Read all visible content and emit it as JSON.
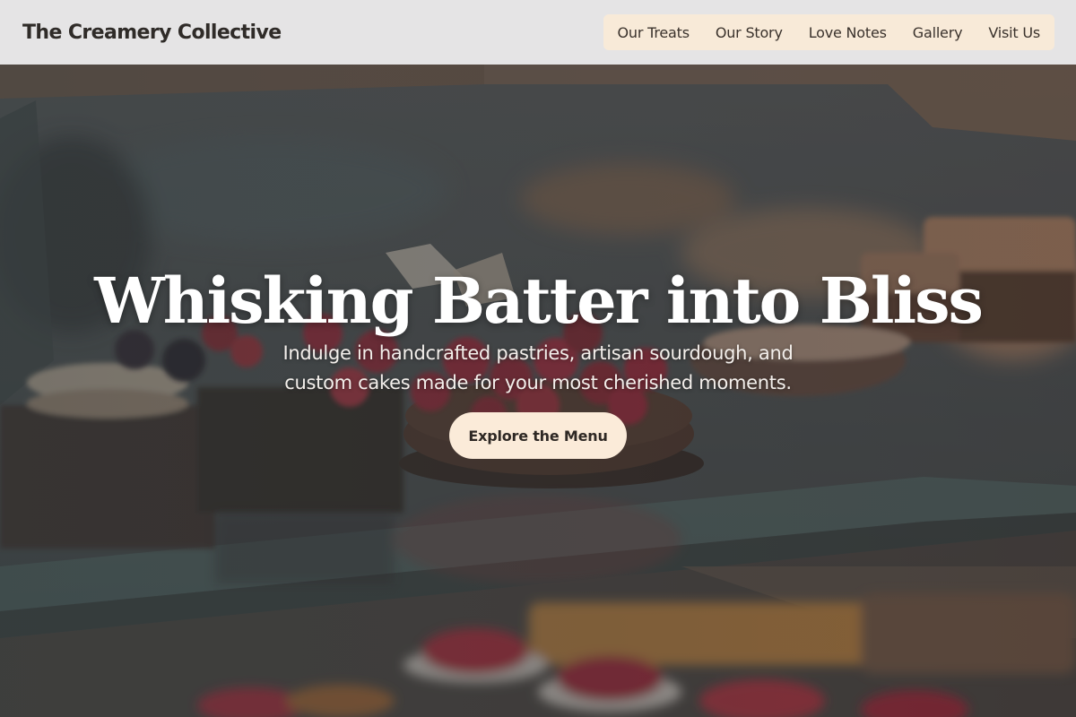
{
  "header": {
    "brand": "The Creamery Collective",
    "nav": [
      {
        "label": "Our Treats"
      },
      {
        "label": "Our Story"
      },
      {
        "label": "Love Notes"
      },
      {
        "label": "Gallery"
      },
      {
        "label": "Visit Us"
      }
    ]
  },
  "hero": {
    "title": "Whisking Batter into Bliss",
    "subtitle": "Indulge in handcrafted pastries, artisan sourdough, and custom cakes made for your most cherished moments.",
    "cta_label": "Explore the Menu"
  },
  "colors": {
    "header_bg": "#e5e4e5",
    "nav_bg": "#f8ead8",
    "cta_bg": "#fbebd9",
    "text_dark": "#2f2b28"
  }
}
